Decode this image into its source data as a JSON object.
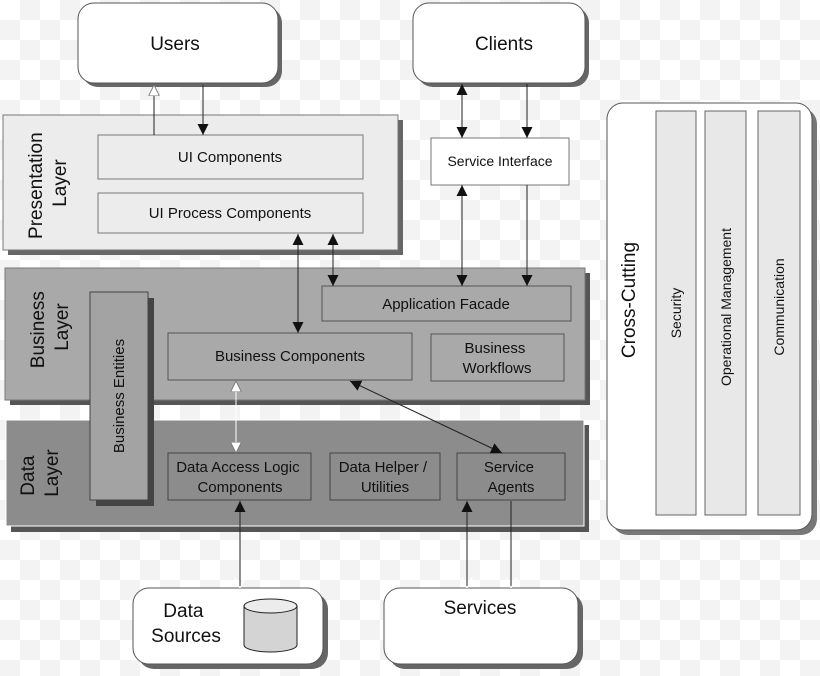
{
  "external": {
    "users": "Users",
    "clients": "Clients",
    "data_sources": [
      "Data",
      "Sources"
    ],
    "services": "Services"
  },
  "presentation_layer": {
    "label": [
      "Presentation",
      "Layer"
    ],
    "ui_components": "UI Components",
    "ui_process_components": "UI Process Components"
  },
  "service_interface": "Service Interface",
  "business_layer": {
    "label": [
      "Business",
      "Layer"
    ],
    "application_facade": "Application Facade",
    "business_components": "Business Components",
    "business_workflows": [
      "Business",
      "Workflows"
    ],
    "business_entities": "Business Entities"
  },
  "data_layer": {
    "label": [
      "Data",
      "Layer"
    ],
    "data_access_logic": [
      "Data Access Logic",
      "Components"
    ],
    "data_helper": [
      "Data Helper /",
      "Utilities"
    ],
    "service_agents": [
      "Service",
      "Agents"
    ]
  },
  "cross_cutting": {
    "label": "Cross-Cutting",
    "columns": [
      "Security",
      "Operational Management",
      "Communication"
    ]
  },
  "colors": {
    "presentation_fill": "#ececec",
    "business_fill": "#a9a9a9",
    "data_fill": "#8c8c8c",
    "shadow": "#555555"
  }
}
